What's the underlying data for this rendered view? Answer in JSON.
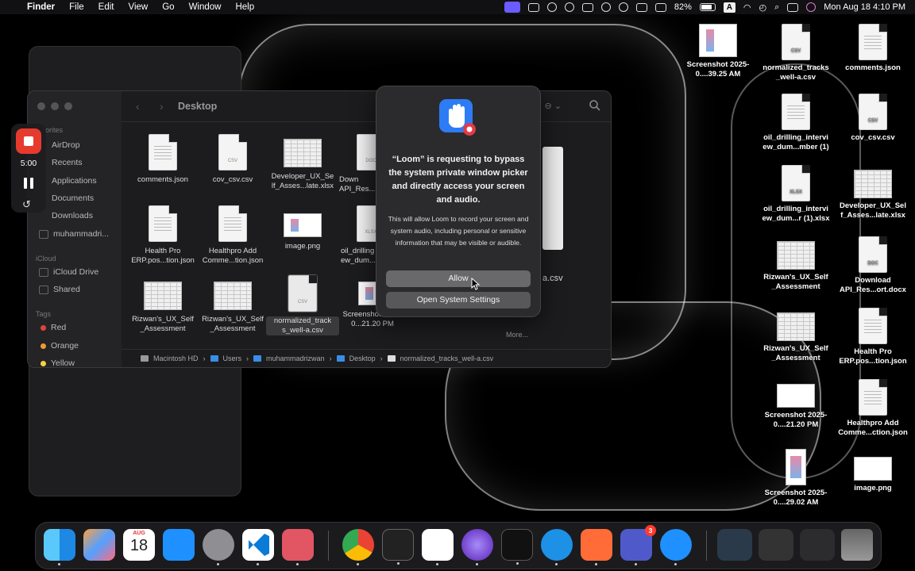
{
  "menubar": {
    "app_name": "Finder",
    "items": [
      "File",
      "Edit",
      "View",
      "Go",
      "Window",
      "Help"
    ],
    "battery": "82%",
    "input_source": "A",
    "datetime": "Mon Aug 18  4:10 PM"
  },
  "loom_widget": {
    "timer": "5:00"
  },
  "finder": {
    "title": "Desktop",
    "sidebar": {
      "favorites_header": "orites",
      "favorites": [
        "AirDrop",
        "Recents",
        "Applications",
        "Documents",
        "Downloads",
        "muhammadri..."
      ],
      "icloud_header": "iCloud",
      "icloud": [
        "iCloud Drive",
        "Shared"
      ],
      "tags_header": "Tags",
      "tags": [
        {
          "label": "Red",
          "color": "#e0443a"
        },
        {
          "label": "Orange",
          "color": "#f09a37"
        },
        {
          "label": "Yellow",
          "color": "#f5d33b"
        }
      ]
    },
    "files": [
      "comments.json",
      "cov_csv.csv",
      "Developer_UX_Se lf_Asses...late.xlsx",
      "Down API_Res...",
      "Health Pro ERP.pos...tion.json",
      "Healthpro Add Comme...tion.json",
      "image.png",
      "oil_drilling ew_dum...",
      "Rizwan's_UX_Self _Assessment",
      "Rizwan's_UX_Self _Assessment",
      "normalized_track s_well-a.csv",
      "Screenshot 2025-0...21.20 PM"
    ],
    "partial_file_label": "a.csv",
    "more_label": "More...",
    "pathbar": [
      "Macintosh HD",
      "Users",
      "muhammadrizwan",
      "Desktop",
      "normalized_tracks_well-a.csv"
    ],
    "ext_labels": {
      "csv": "CSV",
      "doc": "DOC",
      "xlsx": "XLSX"
    }
  },
  "dialog": {
    "title": "“Loom” is requesting to bypass the system private window picker and directly access your screen and audio.",
    "body": "This will allow Loom to record your screen and system audio, including personal or sensitive information that may be visible or audible.",
    "allow_label": "Allow",
    "settings_label": "Open System Settings"
  },
  "desktop_icons": [
    "Screenshot 2025-0....39.25 AM",
    "normalized_tracks _well-a.csv",
    "comments.json",
    "oil_drilling_intervi ew_dum...mber (1)",
    "cov_csv.csv",
    "oil_drilling_intervi ew_dum...r (1).xlsx",
    "Developer_UX_Sel f_Asses...late.xlsx",
    "Rizwan's_UX_Self _Assessment",
    "Download API_Res...ort.docx",
    "Rizwan's_UX_Self _Assessment",
    "Health Pro ERP.pos...tion.json",
    "Screenshot 2025-0....21.20 PM",
    "Healthpro Add Comme...ction.json",
    "Screenshot 2025-0....29.02 AM",
    "image.png"
  ],
  "dock": {
    "calendar_month": "AUG",
    "calendar_day": "18",
    "teams_badge": "3",
    "apps": [
      "Finder",
      "Launchpad",
      "Calendar",
      "App Store",
      "System Settings",
      "Visual Studio Code",
      "Preview",
      "Google Chrome",
      "Terminal",
      "Slack",
      "Loom",
      "ChatGPT",
      "Docker",
      "Postman",
      "Microsoft Teams",
      "Safari",
      "Trash"
    ]
  }
}
